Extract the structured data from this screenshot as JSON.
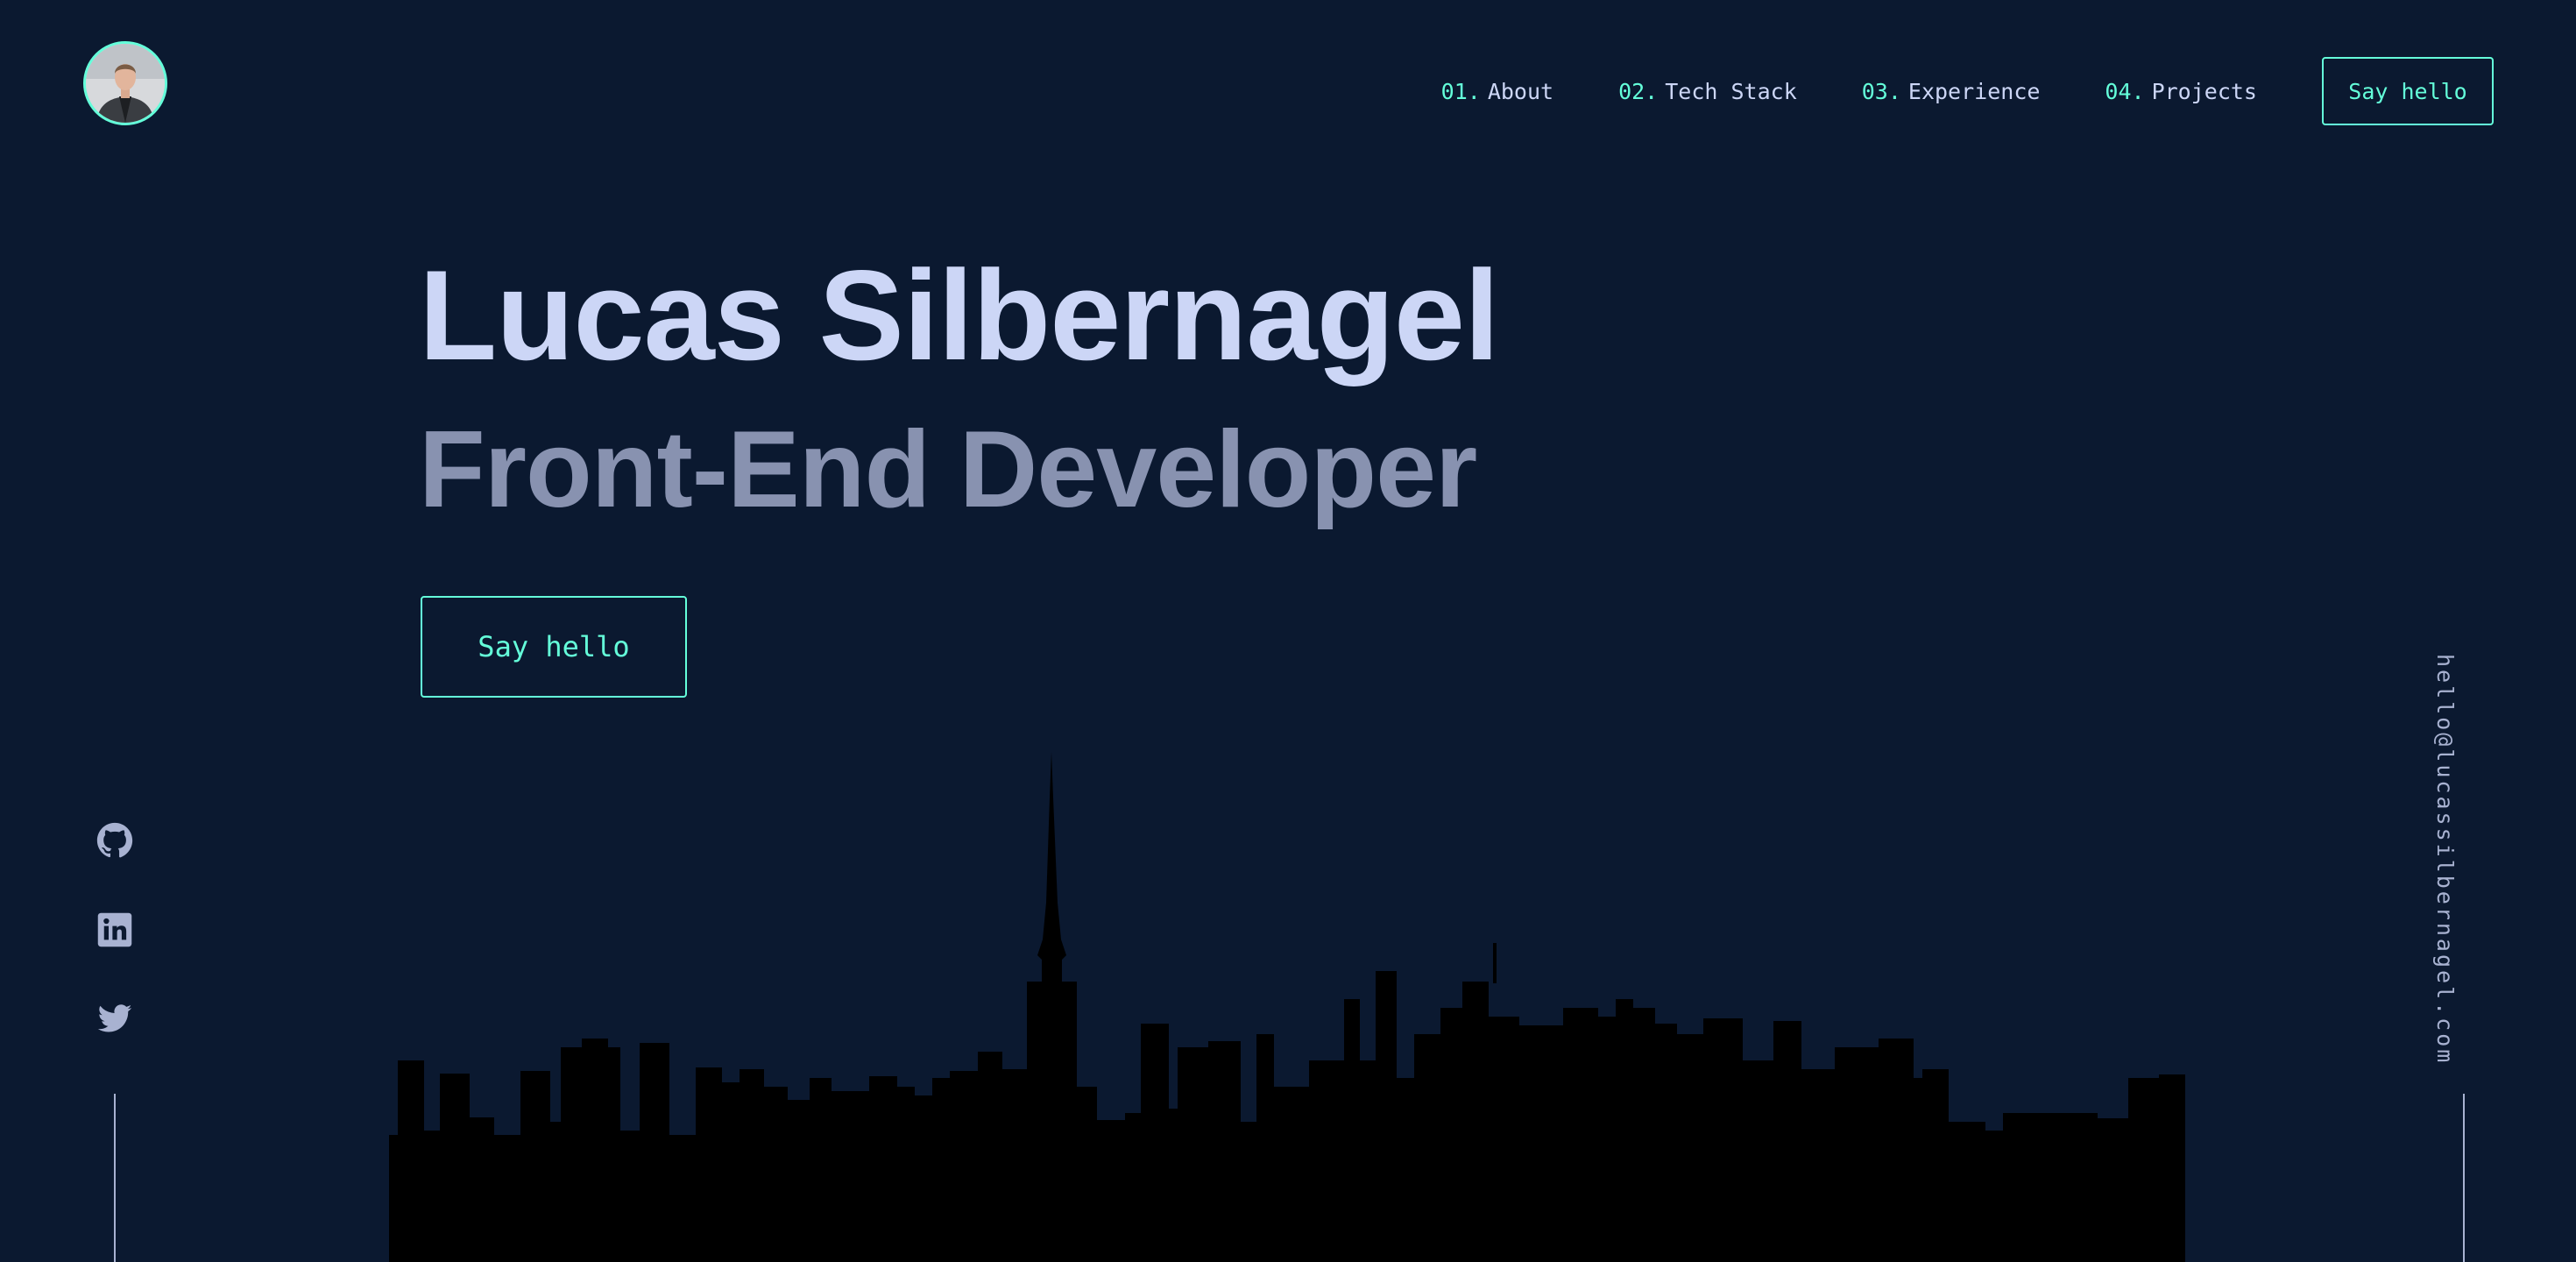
{
  "header": {
    "avatar_alt": "Lucas Silbernagel",
    "nav": [
      {
        "number": "01.",
        "label": "About"
      },
      {
        "number": "02.",
        "label": "Tech Stack"
      },
      {
        "number": "03.",
        "label": "Experience"
      },
      {
        "number": "04.",
        "label": "Projects"
      }
    ],
    "cta_label": "Say hello"
  },
  "hero": {
    "name": "Lucas Silbernagel",
    "role": "Front-End Developer",
    "cta_label": "Say hello"
  },
  "social": {
    "icons": [
      "github-icon",
      "linkedin-icon",
      "twitter-icon"
    ]
  },
  "email": "hello@lucassilbernagel.com",
  "colors": {
    "background": "#0b1930",
    "accent": "#64ffda",
    "heading": "#ccd6f6",
    "subheading": "#8892b0",
    "icon": "#a8b2d1",
    "skyline": "#000000"
  }
}
